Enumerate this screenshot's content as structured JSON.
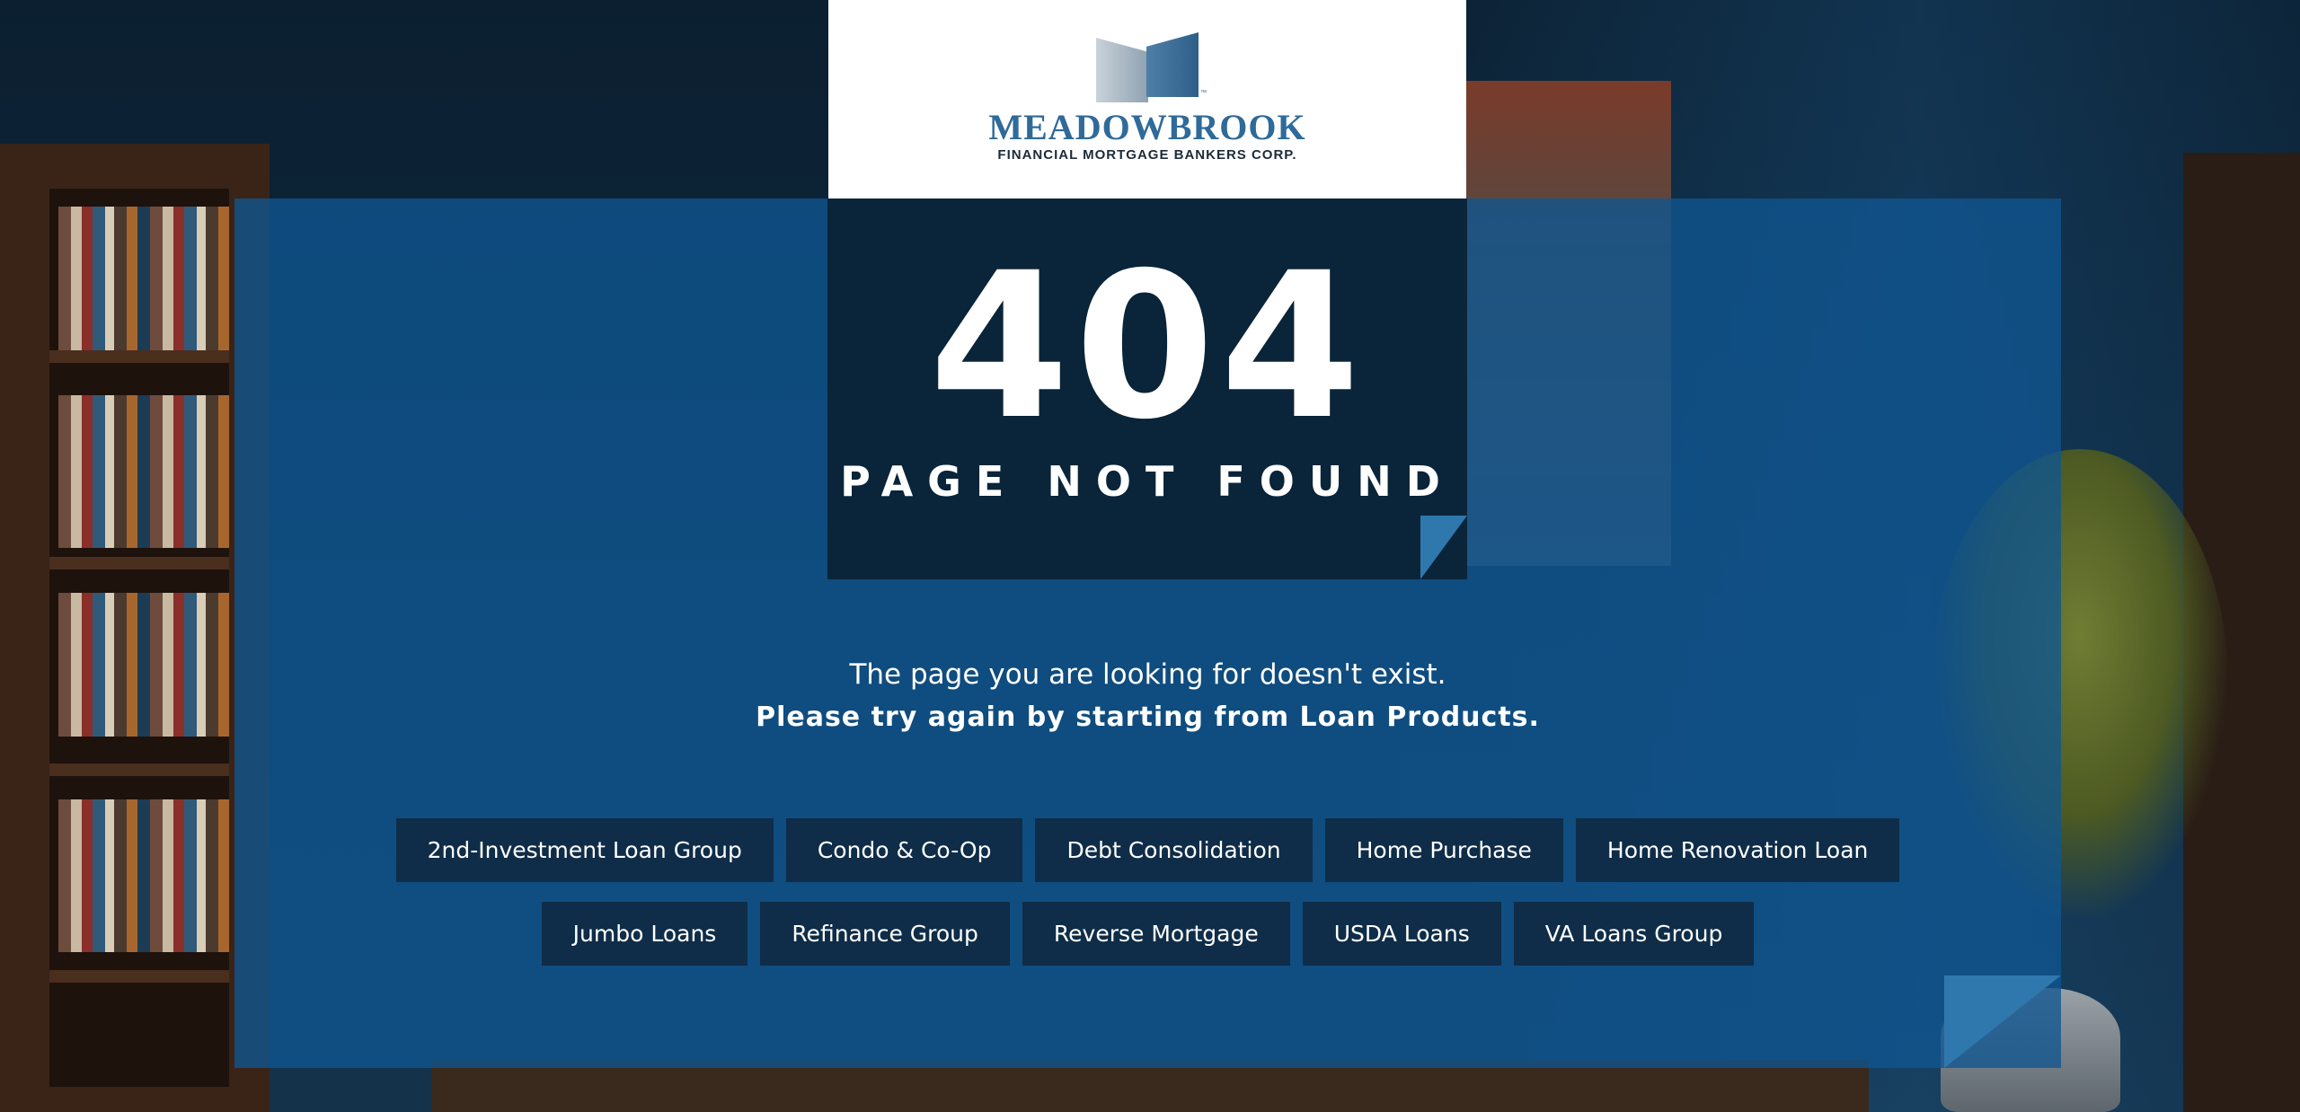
{
  "logo": {
    "icon": "meadowbrook-m-icon",
    "name": "MEADOWBROOK",
    "tagline": "FINANCIAL MORTGAGE BANKERS CORP.",
    "trademark": "™"
  },
  "error": {
    "code": "404",
    "title": "PAGE NOT FOUND"
  },
  "message": {
    "line1": "The page you are looking for doesn't exist.",
    "line2": "Please try again by starting from Loan Products."
  },
  "categories": {
    "row1": [
      "2nd-Investment Loan Group",
      "Condo & Co-Op",
      "Debt Consolidation",
      "Home Purchase",
      "Home Renovation Loan"
    ],
    "row2": [
      "Jumbo Loans",
      "Refinance Group",
      "Reverse Mortgage",
      "USDA Loans",
      "VA Loans Group"
    ]
  },
  "colors": {
    "panel": "#10568f",
    "error_box": "#0a2134",
    "button": "#0f2d48",
    "accent_fold": "#2f78ad",
    "logo_blue": "#2f6a99"
  }
}
